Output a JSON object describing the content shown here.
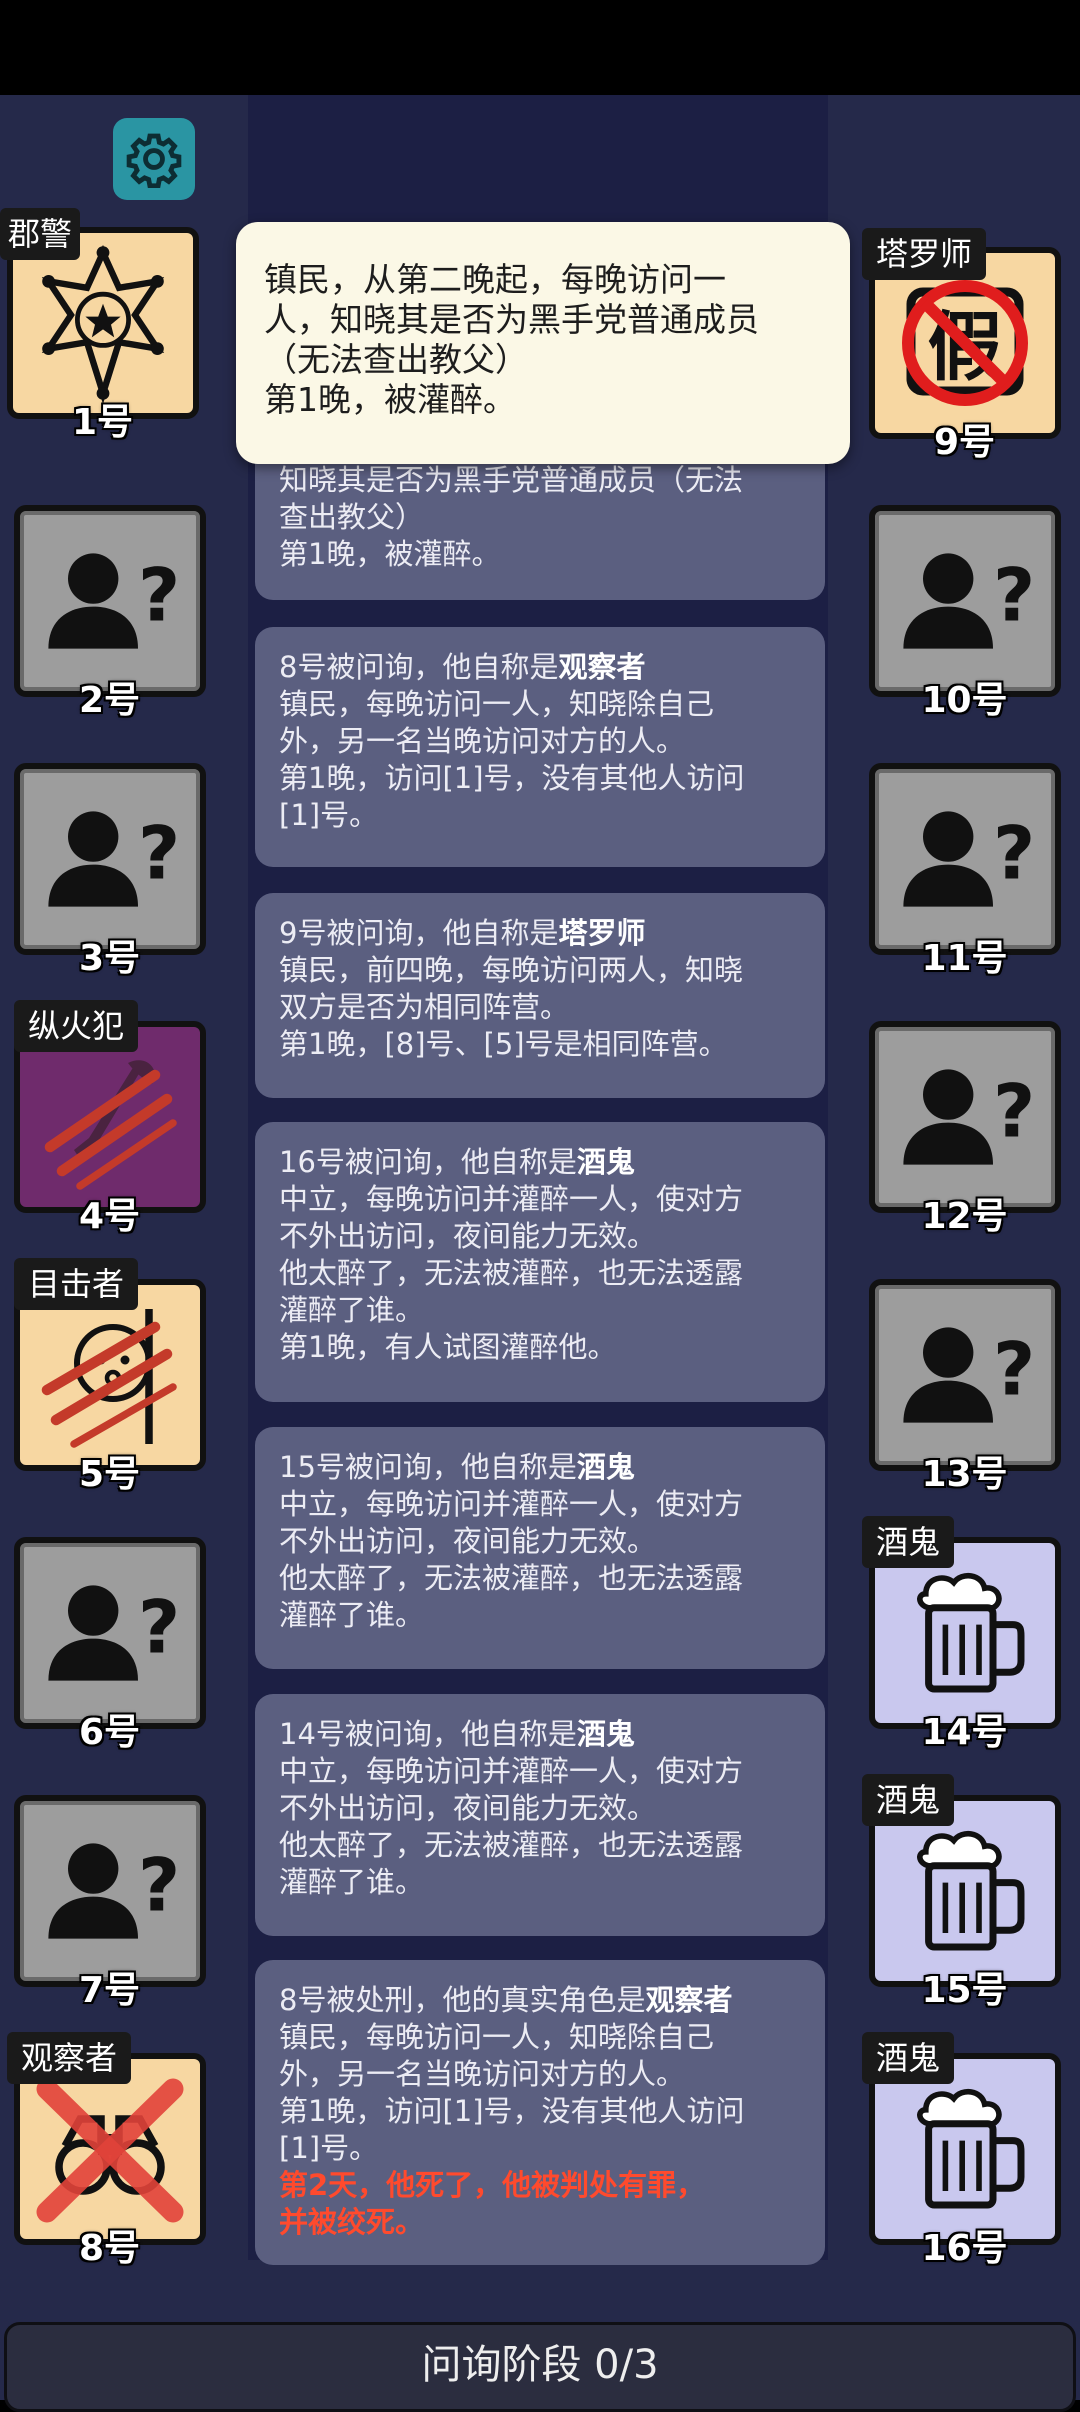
{
  "settings_icon": "gear-icon",
  "popup": {
    "lines": [
      "镇民，从第二晚起，每晚访问一",
      "人，知晓其是否为黑手党普通成员",
      "（无法查出教父）",
      "第1晚，被灌醉。"
    ]
  },
  "players": {
    "p1": {
      "num": "1号",
      "role": "郡警"
    },
    "p2": {
      "num": "2号"
    },
    "p3": {
      "num": "3号"
    },
    "p4": {
      "num": "4号",
      "role": "纵火犯"
    },
    "p5": {
      "num": "5号",
      "role": "目击者"
    },
    "p6": {
      "num": "6号"
    },
    "p7": {
      "num": "7号"
    },
    "p8": {
      "num": "8号",
      "role": "观察者"
    },
    "p9": {
      "num": "9号",
      "role": "塔罗师",
      "badge": "假"
    },
    "p10": {
      "num": "10号"
    },
    "p11": {
      "num": "11号"
    },
    "p12": {
      "num": "12号"
    },
    "p13": {
      "num": "13号"
    },
    "p14": {
      "num": "14号",
      "role": "酒鬼"
    },
    "p15": {
      "num": "15号",
      "role": "酒鬼"
    },
    "p16": {
      "num": "16号",
      "role": "酒鬼"
    }
  },
  "log": {
    "m0": {
      "lines": [
        "知晓其是否为黑手党普通成员（无法",
        "查出教父）",
        "第1晚，被灌醉。"
      ]
    },
    "m1": {
      "prefix": "8号被问询，他自称是",
      "role": "观察者",
      "lines": [
        "镇民，每晚访问一人，知晓除自己",
        "外，另一名当晚访问对方的人。",
        "第1晚，访问[1]号，没有其他人访问",
        "[1]号。"
      ]
    },
    "m2": {
      "prefix": "9号被问询，他自称是",
      "role": "塔罗师",
      "lines": [
        "镇民，前四晚，每晚访问两人，知晓",
        "双方是否为相同阵营。",
        "第1晚，[8]号、[5]号是相同阵营。"
      ]
    },
    "m3": {
      "prefix": "16号被问询，他自称是",
      "role": "酒鬼",
      "lines": [
        "中立，每晚访问并灌醉一人，使对方",
        "不外出访问，夜间能力无效。",
        "他太醉了，无法被灌醉，也无法透露",
        "灌醉了谁。",
        "第1晚，有人试图灌醉他。"
      ]
    },
    "m4": {
      "prefix": "15号被问询，他自称是",
      "role": "酒鬼",
      "lines": [
        "中立，每晚访问并灌醉一人，使对方",
        "不外出访问，夜间能力无效。",
        "他太醉了，无法被灌醉，也无法透露",
        "灌醉了谁。"
      ]
    },
    "m5": {
      "prefix": "14号被问询，他自称是",
      "role": "酒鬼",
      "lines": [
        "中立，每晚访问并灌醉一人，使对方",
        "不外出访问，夜间能力无效。",
        "他太醉了，无法被灌醉，也无法透露",
        "灌醉了谁。"
      ]
    },
    "m6": {
      "prefix": "8号被处刑，他的真实角色是",
      "role": "观察者",
      "lines": [
        "镇民，每晚访问一人，知晓除自己",
        "外，另一名当晚访问对方的人。",
        "第1晚，访问[1]号，没有其他人访问",
        "[1]号。"
      ],
      "death_lines": [
        "第2天，他死了，他被判处有罪，",
        "并被绞死。"
      ]
    }
  },
  "phase": "问询阶段 0/3",
  "colors": {
    "background": "#25294a",
    "log_bg": "#1c1f44",
    "message": "#5b5f80",
    "death_text": "#ff4a2d",
    "town_card": "#f7d7a2",
    "drunk_card": "#c9c8ee",
    "settings": "#2a95a3"
  }
}
